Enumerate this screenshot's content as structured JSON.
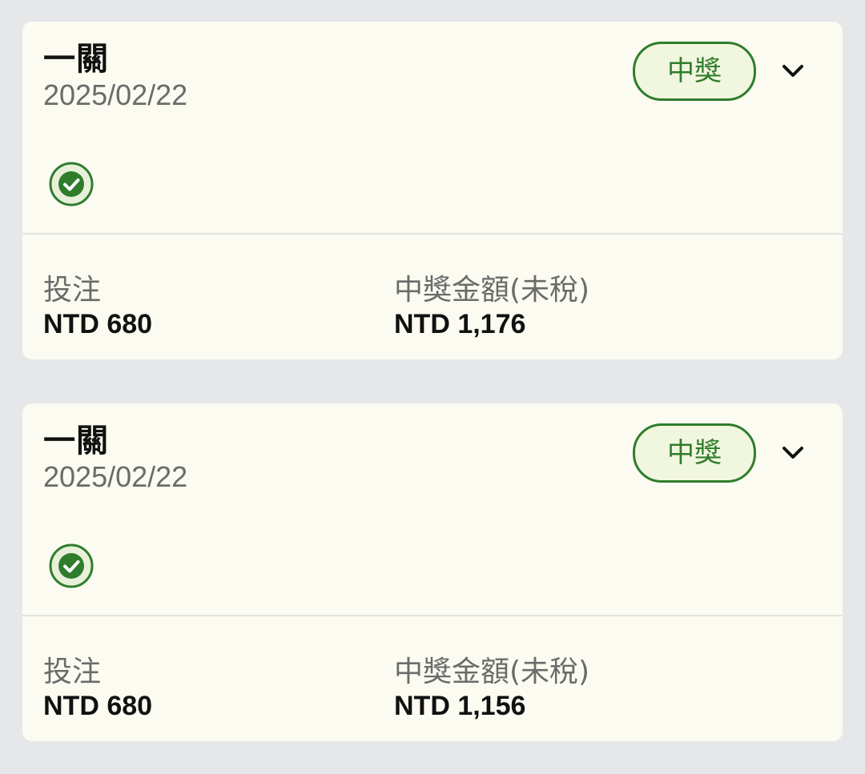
{
  "colors": {
    "page_background": "#e6e7e9",
    "card_background": "#fcfbf1",
    "accent_green": "#2f7d2c",
    "badge_fill": "#f1f6df",
    "label_gray": "#6b6b6b",
    "value_black": "#111111"
  },
  "cards": [
    {
      "title": "一關",
      "date": "2025/02/22",
      "status_badge": "中獎",
      "status_icon": "check-circle-icon",
      "expand_icon": "chevron-down-icon",
      "bet_label": "投注",
      "bet_value": "NTD 680",
      "prize_label": "中獎金額(未稅)",
      "prize_value": "NTD 1,176"
    },
    {
      "title": "一關",
      "date": "2025/02/22",
      "status_badge": "中獎",
      "status_icon": "check-circle-icon",
      "expand_icon": "chevron-down-icon",
      "bet_label": "投注",
      "bet_value": "NTD 680",
      "prize_label": "中獎金額(未稅)",
      "prize_value": "NTD 1,156"
    }
  ]
}
